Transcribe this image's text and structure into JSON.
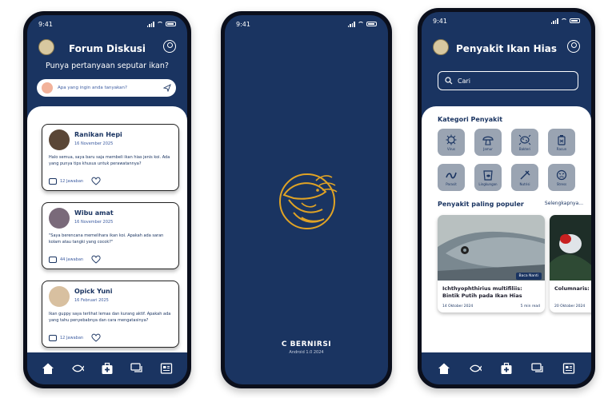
{
  "status_time": "9:41",
  "forum": {
    "title": "Forum Diskusi",
    "subtitle": "Punya pertanyaan seputar ikan?",
    "ask_placeholder": "Apa yang ingin anda tanyakan?",
    "posts": [
      {
        "name": "Ranikan Hepi",
        "date": "16 November 2025",
        "text": "Halo semua, saya baru saja membeli ikan hias jenis koi. Ada yang punya tips khusus untuk perawatannya?",
        "replies": "12 Jawaban"
      },
      {
        "name": "Wibu amat",
        "date": "16 November 2025",
        "text": "\"Saya berencana memelihara ikan koi. Apakah ada saran kolam atau tangki yang cocok?\"",
        "replies": "44 Jawaban"
      },
      {
        "name": "Opick Yuni",
        "date": "16 Februari 2025",
        "text": "Ikan guppy saya terlihat lemas dan kurang aktif. Apakah ada yang tahu penyebabnya dan cara mengatasinya?",
        "replies": "12 Jawaban"
      }
    ]
  },
  "splash": {
    "brand": "C BERNIRSI",
    "version": "Android 1.0 2024"
  },
  "disease": {
    "title": "Penyakit Ikan Hias",
    "search_placeholder": "Cari",
    "category_heading": "Kategori Penyakit",
    "categories": [
      "Virus",
      "Jamur",
      "Bakteri",
      "Racun",
      "Parasit",
      "Lingkungan",
      "Nutrisi",
      "Stress"
    ],
    "popular_heading": "Penyakit paling populer",
    "see_all": "Selengkapnya...",
    "articles": [
      {
        "title": "Ichthyophthirius multifiliis: Bintik Putih pada Ikan Hias",
        "date": "14 Oktober 2024",
        "read": "5 min read",
        "badge": "Baca Nanti"
      },
      {
        "title": "Columnaris: Le pada Kulit Ika",
        "date": "20 Oktober 2024",
        "read": "",
        "badge": ""
      }
    ]
  },
  "colors": {
    "navy": "#1a3461",
    "gold": "#e0a325",
    "card_bg": "#ffffff",
    "category_bg": "#9aa4b2"
  }
}
